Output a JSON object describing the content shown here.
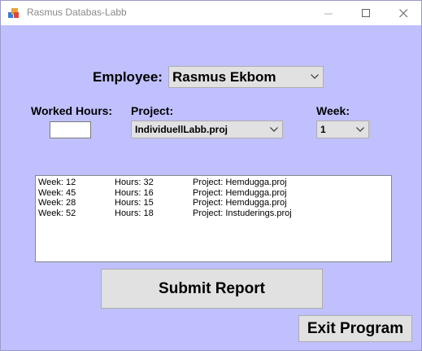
{
  "window": {
    "title": "Rasmus Databas-Labb"
  },
  "employee": {
    "label": "Employee:",
    "selected": "Rasmus Ekbom"
  },
  "hours": {
    "label": "Worked Hours:",
    "value": ""
  },
  "project": {
    "label": "Project:",
    "selected": "IndividuellLabb.proj"
  },
  "week": {
    "label": "Week:",
    "selected": "1"
  },
  "reports": [
    {
      "week": "Week: 12",
      "hours": "Hours: 32",
      "project": "Project: Hemdugga.proj"
    },
    {
      "week": "Week: 45",
      "hours": "Hours: 16",
      "project": "Project: Hemdugga.proj"
    },
    {
      "week": "Week: 28",
      "hours": "Hours: 15",
      "project": "Project: Hemdugga.proj"
    },
    {
      "week": "Week: 52",
      "hours": "Hours: 18",
      "project": "Project: Instuderings.proj"
    }
  ],
  "buttons": {
    "submit": "Submit Report",
    "exit": "Exit Program"
  },
  "colors": {
    "background": "#c0c0ff",
    "button": "#e1e1e1"
  }
}
